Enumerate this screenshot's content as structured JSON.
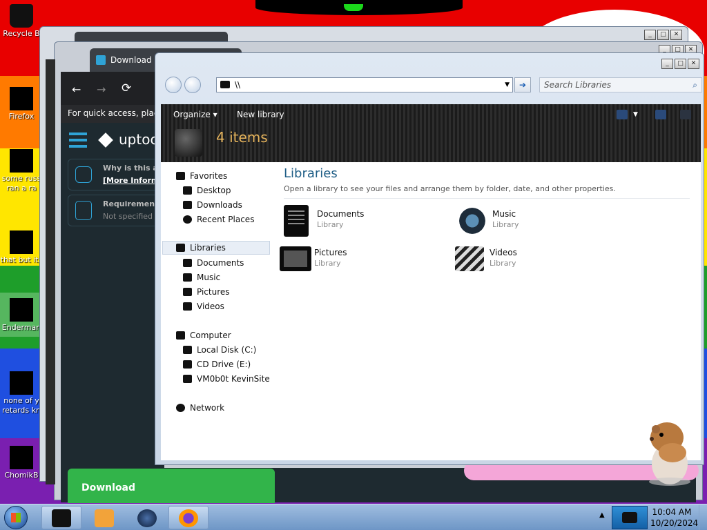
{
  "desktop": {
    "icons": [
      {
        "label_1": "Recycle B",
        "label_2": ""
      },
      {
        "label_1": "Firefox",
        "label_2": ""
      },
      {
        "label_1": "some russ",
        "label_2": "ran a ra"
      },
      {
        "label_1": "that but its",
        "label_2": ""
      },
      {
        "label_1": "Enderman",
        "label_2": ""
      },
      {
        "label_1": "none of y",
        "label_2": "retards kn"
      },
      {
        "label_1": "ChomikB",
        "label_2": ""
      }
    ]
  },
  "browser": {
    "tab_title": "Download U",
    "back_label": "←",
    "forward_label": "→",
    "reload_label": "⟳",
    "quick_access_text": "For quick access, place y",
    "brand": "uptoc",
    "why_label": "Why is this ap",
    "more_info_label": "[More Informa",
    "requirements_label": "Requirements",
    "not_specified": "Not specified",
    "download_label": "Download"
  },
  "explorer": {
    "address_value": "\\\\",
    "search_placeholder": "Search Libraries",
    "toolbar": {
      "organize_label": "Organize",
      "new_library_label": "New library",
      "item_count": "4 items"
    },
    "nav": {
      "favorites": "Favorites",
      "desktop": "Desktop",
      "downloads": "Downloads",
      "recent_places": "Recent Places",
      "libraries": "Libraries",
      "documents": "Documents",
      "music": "Music",
      "pictures": "Pictures",
      "videos": "Videos",
      "computer": "Computer",
      "local_disk": "Local Disk (C:)",
      "cd_drive": "CD Drive (E:)",
      "vm_site": "VM0b0t KevinSite",
      "network": "Network"
    },
    "content": {
      "title": "Libraries",
      "description": "Open a library to see your files and arrange them by folder, date, and other properties.",
      "libraries": [
        {
          "name": "Documents",
          "type": "Library"
        },
        {
          "name": "Music",
          "type": "Library"
        },
        {
          "name": "Pictures",
          "type": "Library"
        },
        {
          "name": "Videos",
          "type": "Library"
        }
      ]
    }
  },
  "taskbar": {
    "time": "10:04 AM",
    "date": "10/20/2024"
  },
  "colors": {
    "explorer_title": "#1f5e86",
    "item_count": "#e6b45c",
    "download_green": "#32b44a",
    "browser_body": "#1e2a30"
  }
}
